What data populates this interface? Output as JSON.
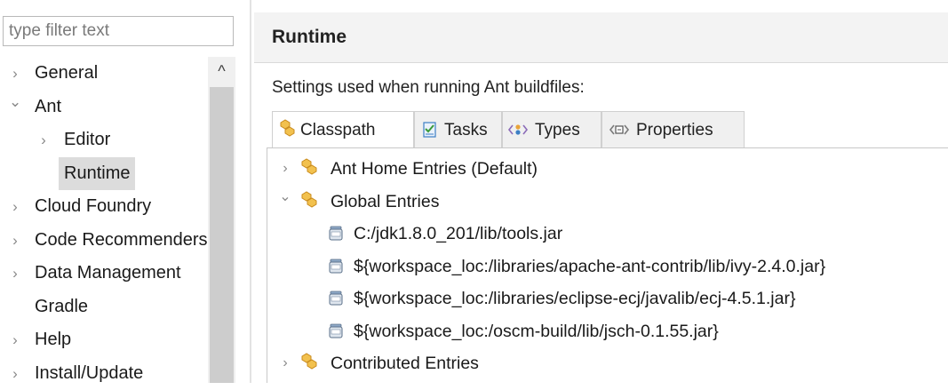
{
  "sidebar": {
    "filter_placeholder": "type filter text",
    "items": [
      {
        "label": "General",
        "chevron": "›",
        "level": 0
      },
      {
        "label": "Ant",
        "chevron": "⌄",
        "level": 0
      },
      {
        "label": "Editor",
        "chevron": "›",
        "level": 1
      },
      {
        "label": "Runtime",
        "chevron": "",
        "level": 1,
        "selected": true
      },
      {
        "label": "Cloud Foundry",
        "chevron": "›",
        "level": 0
      },
      {
        "label": "Code Recommenders",
        "chevron": "›",
        "level": 0
      },
      {
        "label": "Data Management",
        "chevron": "›",
        "level": 0
      },
      {
        "label": "Gradle",
        "chevron": "",
        "level": 0
      },
      {
        "label": "Help",
        "chevron": "›",
        "level": 0
      },
      {
        "label": "Install/Update",
        "chevron": "›",
        "level": 0
      }
    ],
    "scroll_up_glyph": "^"
  },
  "main": {
    "title": "Runtime",
    "description": "Settings used when running Ant buildfiles:",
    "tabs": [
      {
        "label": "Classpath",
        "icon": "classpath-icon"
      },
      {
        "label": "Tasks",
        "icon": "tasks-icon"
      },
      {
        "label": "Types",
        "icon": "types-icon"
      },
      {
        "label": "Properties",
        "icon": "properties-icon"
      }
    ],
    "active_tab": "Classpath",
    "classpath_tree": [
      {
        "label": "Ant Home Entries (Default)",
        "chevron": "›",
        "level": 0,
        "icon": "classpath-icon"
      },
      {
        "label": "Global Entries",
        "chevron": "⌄",
        "level": 0,
        "icon": "classpath-icon"
      },
      {
        "label": "C:/jdk1.8.0_201/lib/tools.jar",
        "chevron": "",
        "level": 1,
        "icon": "jar-icon"
      },
      {
        "label": "${workspace_loc:/libraries/apache-ant-contrib/lib/ivy-2.4.0.jar}",
        "chevron": "",
        "level": 1,
        "icon": "jar-icon"
      },
      {
        "label": "${workspace_loc:/libraries/eclipse-ecj/javalib/ecj-4.5.1.jar}",
        "chevron": "",
        "level": 1,
        "icon": "jar-icon"
      },
      {
        "label": "${workspace_loc:/oscm-build/lib/jsch-0.1.55.jar}",
        "chevron": "",
        "level": 1,
        "icon": "jar-icon"
      },
      {
        "label": "Contributed Entries",
        "chevron": "›",
        "level": 0,
        "icon": "classpath-icon"
      }
    ]
  },
  "colors": {
    "accent_orange": "#e8a33a",
    "accent_blue": "#3d7fc4",
    "selection": "#dcdcdc",
    "header_bg": "#f3f3f3"
  }
}
